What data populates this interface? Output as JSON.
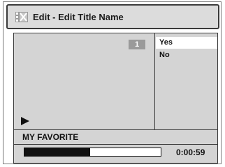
{
  "title_bar": {
    "icon": "edit-scene-icon",
    "title": "Edit - Edit Title Name"
  },
  "preview": {
    "chapter_number": "1",
    "play_icon": "play-icon"
  },
  "options": [
    {
      "label": "Yes",
      "selected": true
    },
    {
      "label": "No",
      "selected": false
    }
  ],
  "title_name": "MY FAVORITE",
  "playback": {
    "progress_fraction": 0.48,
    "time": "0:00:59"
  },
  "colors": {
    "panel": "#d4d4d4",
    "title_bar": "#dcdcdc",
    "highlight": "#ffffff",
    "chapter_badge": "#9a9a9a",
    "progress_fill": "#111111"
  }
}
